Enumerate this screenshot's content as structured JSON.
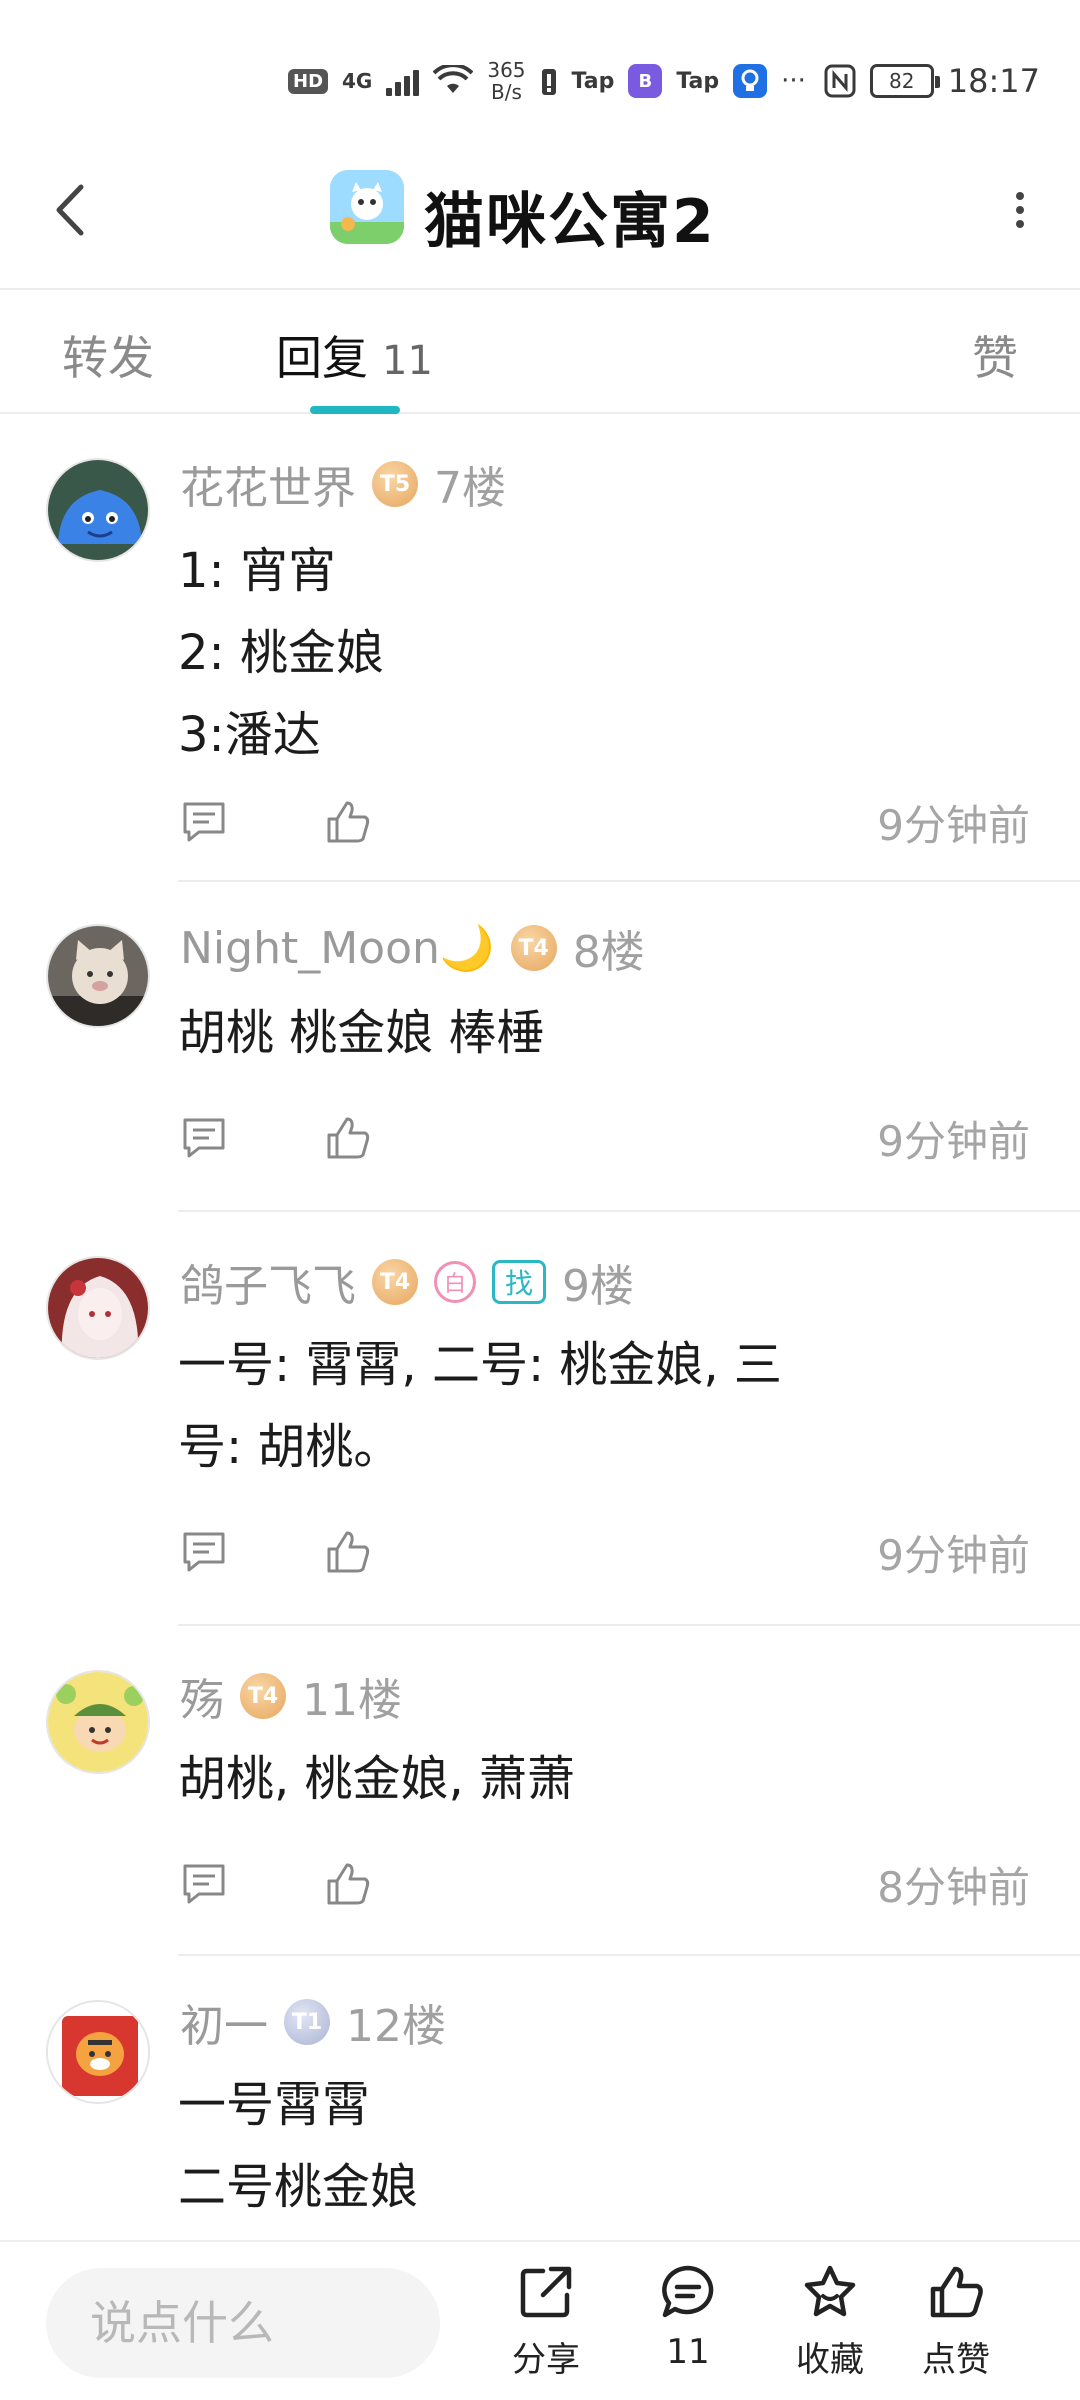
{
  "status_bar": {
    "hd": "HD",
    "network": "4G",
    "speed_value": "365",
    "speed_unit": "B/s",
    "tap1": "Tap",
    "tap2": "Tap",
    "more": "···",
    "battery": "82",
    "time": "18:17"
  },
  "header": {
    "title": "猫咪公寓2"
  },
  "tabs": [
    {
      "label": "转发"
    },
    {
      "label": "回复",
      "count": "11"
    },
    {
      "label": "赞"
    }
  ],
  "replies": [
    {
      "user": "花花世界",
      "level": "T5",
      "floor": "7楼",
      "lines": [
        "1: 宵宵",
        "2: 桃金娘",
        "3:潘达"
      ],
      "time": "9分钟前"
    },
    {
      "user": "Night_Moon🌙",
      "level": "T4",
      "floor": "8楼",
      "lines": [
        "胡桃 桃金娘 棒棰"
      ],
      "time": "9分钟前"
    },
    {
      "user": "鸽子飞飞",
      "level": "T4",
      "extra_badge": "白",
      "find_badge": "找",
      "floor": "9楼",
      "lines": [
        "一号: 霄霄, 二号: 桃金娘, 三",
        "号: 胡桃。"
      ],
      "time": "9分钟前"
    },
    {
      "user": "殇",
      "level": "T4",
      "floor": "11楼",
      "lines": [
        "胡桃, 桃金娘, 萧萧"
      ],
      "time": "8分钟前"
    },
    {
      "user": "初一",
      "level": "T1",
      "floor": "12楼",
      "lines": [
        "一号霄霄",
        "二号桃金娘"
      ],
      "time": ""
    }
  ],
  "bottom_bar": {
    "input_placeholder": "说点什么",
    "share_label": "分享",
    "comment_count": "11",
    "favorite_label": "收藏",
    "like_label": "点赞"
  },
  "colors": {
    "accent": "#1fb8c2",
    "level_gold": "#e7a65e",
    "level_silver": "#aab3d2",
    "badge_pink": "#f28fb4"
  }
}
